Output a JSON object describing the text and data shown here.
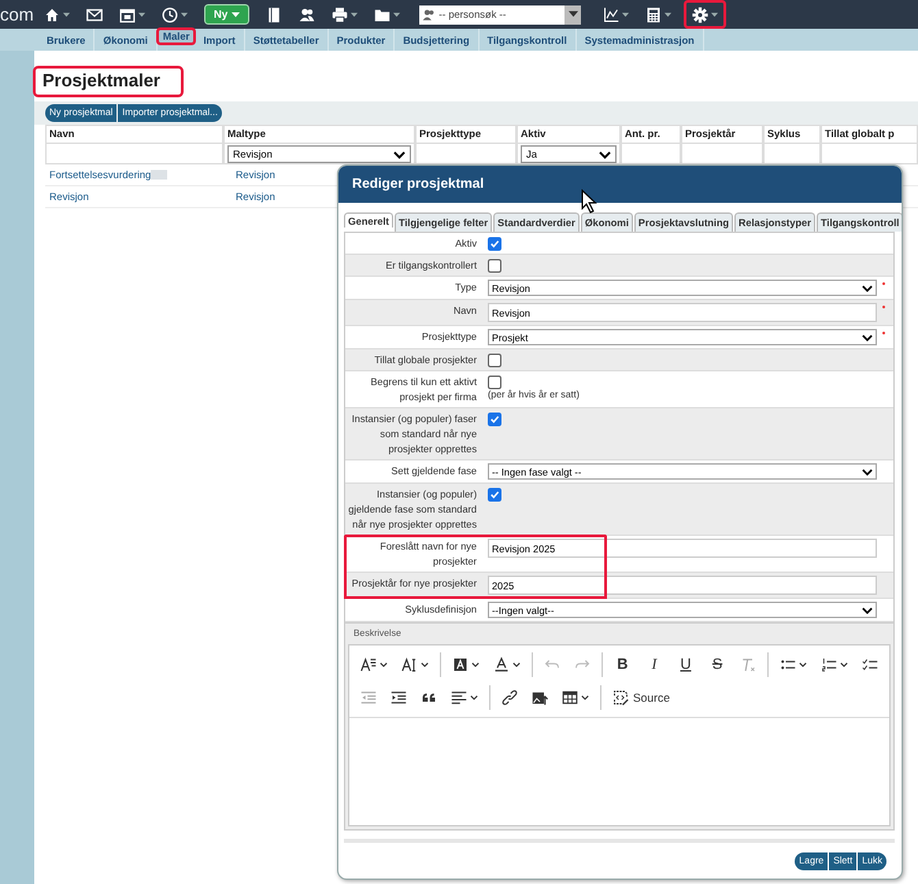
{
  "topbar": {
    "logo_text": "com",
    "new_button": "Ny",
    "person_search": {
      "placeholder": "-- personsøk --"
    },
    "settings_highlighted": true
  },
  "nav_tabs": [
    {
      "label": "Brukere",
      "selected": false,
      "highlighted": false
    },
    {
      "label": "Økonomi",
      "selected": false,
      "highlighted": false
    },
    {
      "label": "Maler",
      "selected": true,
      "highlighted": true
    },
    {
      "label": "Import",
      "selected": false,
      "highlighted": false
    },
    {
      "label": "Støttetabeller",
      "selected": false,
      "highlighted": false
    },
    {
      "label": "Produkter",
      "selected": false,
      "highlighted": false
    },
    {
      "label": "Budsjettering",
      "selected": false,
      "highlighted": false
    },
    {
      "label": "Tilgangskontroll",
      "selected": false,
      "highlighted": false
    },
    {
      "label": "Systemadministrasjon",
      "selected": false,
      "highlighted": false
    }
  ],
  "page": {
    "title": "Prosjektmaler",
    "title_highlighted": true,
    "buttons": [
      "Ny prosjektmal",
      "Importer prosjektmal..."
    ]
  },
  "table": {
    "columns": [
      "Navn",
      "Maltype",
      "Prosjekttype",
      "Aktiv",
      "Ant. pr.",
      "Prosjektår",
      "Syklus",
      "Tillat globalt p"
    ],
    "filters": {
      "maltype": "Revisjon",
      "aktiv": "Ja"
    },
    "rows": [
      {
        "navn": "Fortsettelsesvurdering",
        "redacted": true,
        "maltype": "Revisjon"
      },
      {
        "navn": "Revisjon",
        "redacted": false,
        "maltype": "Revisjon"
      }
    ]
  },
  "dialog": {
    "title": "Rediger prosjektmal",
    "tabs": [
      {
        "label": "Generelt",
        "selected": true
      },
      {
        "label": "Tilgjengelige felter",
        "selected": false
      },
      {
        "label": "Standardverdier",
        "selected": false
      },
      {
        "label": "Økonomi",
        "selected": false
      },
      {
        "label": "Prosjektavslutning",
        "selected": false
      },
      {
        "label": "Relasjonstyper",
        "selected": false
      },
      {
        "label": "Tilgangskontroll",
        "selected": false
      }
    ],
    "fields": [
      {
        "label": "Aktiv",
        "kind": "checkbox",
        "checked": true,
        "highlighted": false
      },
      {
        "label": "Er tilgangskontrollert",
        "kind": "checkbox",
        "checked": false,
        "highlighted": false
      },
      {
        "label": "Type",
        "kind": "select",
        "value": "Revisjon",
        "required": true,
        "highlighted": false
      },
      {
        "label": "Navn",
        "kind": "text",
        "value": "Revisjon",
        "required": true,
        "highlighted": false
      },
      {
        "label": "Prosjekttype",
        "kind": "select",
        "value": "Prosjekt",
        "required": true,
        "highlighted": false
      },
      {
        "label": "Tillat globale prosjekter",
        "kind": "checkbox",
        "checked": false,
        "highlighted": false
      },
      {
        "label": "Begrens til kun ett aktivt prosjekt per firma",
        "kind": "checkbox",
        "checked": false,
        "note": "(per år hvis år er satt)",
        "highlighted": false
      },
      {
        "label": "Instansier (og populer) faser som standard når nye prosjekter opprettes",
        "kind": "checkbox",
        "checked": true,
        "highlighted": false
      },
      {
        "label": "Sett gjeldende fase",
        "kind": "select",
        "value": "-- Ingen fase valgt --",
        "required": false,
        "highlighted": false
      },
      {
        "label": "Instansier (og populer) gjeldende fase som standard når nye prosjekter opprettes",
        "kind": "checkbox",
        "checked": true,
        "highlighted": false
      },
      {
        "label": "Foreslått navn for nye prosjekter",
        "kind": "text",
        "value": "Revisjon 2025",
        "required": false,
        "highlighted": true
      },
      {
        "label": "Prosjektår for nye prosjekter",
        "kind": "text",
        "value": "2025",
        "required": false,
        "highlighted": true
      },
      {
        "label": "Syklusdefinisjon",
        "kind": "select",
        "value": "--Ingen valgt--",
        "required": false,
        "highlighted": false
      }
    ],
    "editor": {
      "label": "Beskrivelse",
      "format_glyphs": [
        "B",
        "I",
        "U",
        "S"
      ],
      "source_label": "Source"
    },
    "buttons": [
      "Lagre",
      "Slett",
      "Lukk"
    ]
  }
}
